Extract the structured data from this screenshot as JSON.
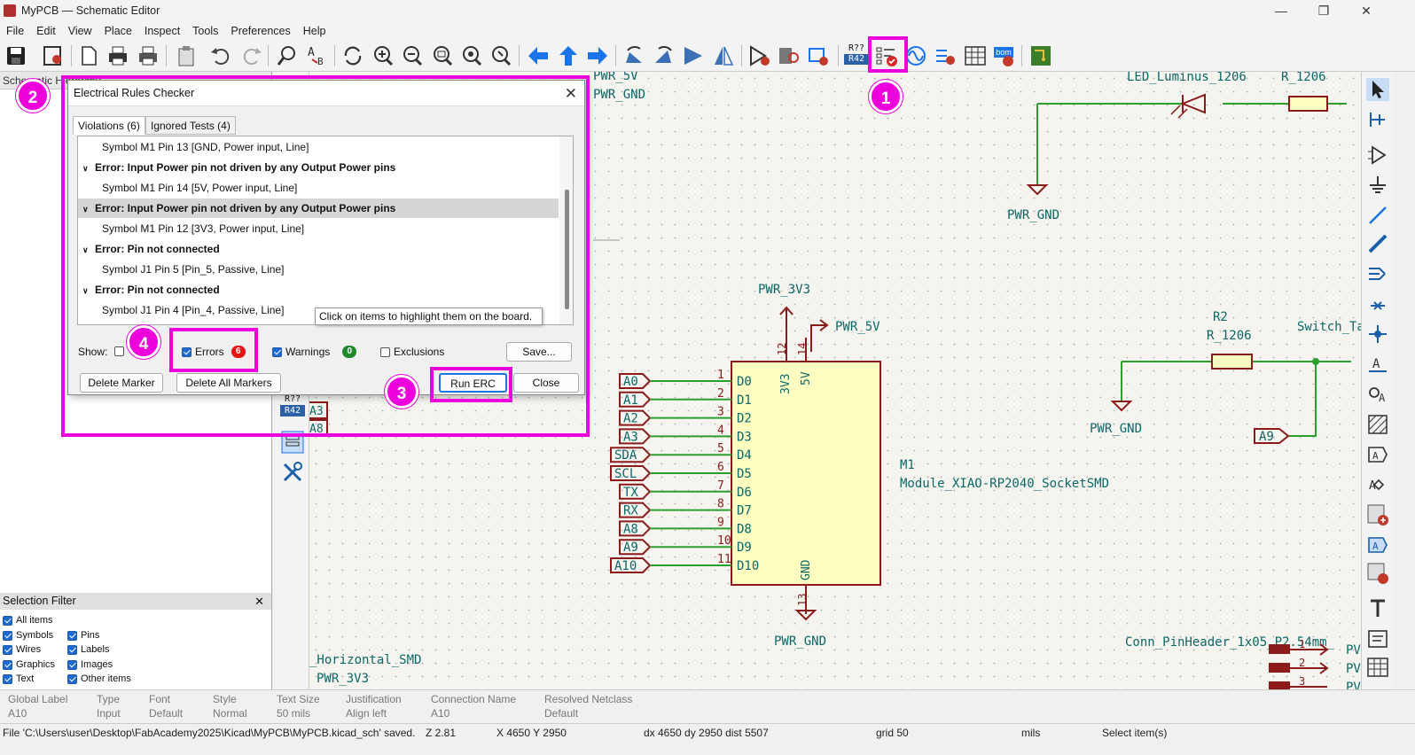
{
  "window": {
    "title": "MyPCB — Schematic Editor",
    "controls": {
      "minimize": "—",
      "maximize": "❐",
      "close": "✕"
    }
  },
  "menu": [
    "File",
    "Edit",
    "View",
    "Place",
    "Inspect",
    "Tools",
    "Preferences",
    "Help"
  ],
  "toolbar": {
    "icons": [
      "save-icon",
      "schematic-setup-icon",
      "page-settings-icon",
      "print-icon",
      "plot-icon",
      "paste-icon",
      "undo-icon",
      "redo-icon",
      "find-icon",
      "find-replace-icon",
      "refresh-icon",
      "zoom-in-icon",
      "zoom-out-icon",
      "zoom-fit-icon",
      "zoom-objects-icon",
      "zoom-tool-icon",
      "navigate-back-icon",
      "navigate-up-icon",
      "navigate-forward-icon",
      "rotate-ccw-icon",
      "rotate-cw-icon",
      "mirror-v-icon",
      "mirror-h-icon",
      "symbol-editor-icon",
      "symbol-browser-icon",
      "footprint-assign-icon",
      "annotate-icon",
      "erc-icon",
      "simulator-icon",
      "bus-icon",
      "fields-table-icon",
      "bom-icon",
      "pcb-editor-icon"
    ],
    "annotate_text_1": "R??",
    "annotate_text_2": "R42",
    "bom_text": "bom"
  },
  "left_panel": {
    "header": "Schematic Hierarchy"
  },
  "left_tools": {
    "annotate_text_1": "R??",
    "annotate_text_2": "R42"
  },
  "selection_filter": {
    "title": "Selection Filter",
    "close": "✕",
    "items": [
      {
        "label": "All items",
        "checked": true
      },
      {
        "label": "Symbols",
        "checked": true
      },
      {
        "label": "Pins",
        "checked": true
      },
      {
        "label": "Wires",
        "checked": true
      },
      {
        "label": "Labels",
        "checked": true
      },
      {
        "label": "Graphics",
        "checked": true
      },
      {
        "label": "Images",
        "checked": true
      },
      {
        "label": "Text",
        "checked": true
      },
      {
        "label": "Other items",
        "checked": true
      }
    ]
  },
  "dialog": {
    "title": "Electrical Rules Checker",
    "close": "✕",
    "tabs": [
      {
        "label": "Violations (6)"
      },
      {
        "label": "Ignored Tests (4)"
      }
    ],
    "violations": [
      {
        "kind": "sym",
        "text": "Symbol M1 Pin 13 [GND, Power input, Line]"
      },
      {
        "kind": "err",
        "text": "Error: Input Power pin not driven by any Output Power pins"
      },
      {
        "kind": "sym",
        "text": "Symbol M1 Pin 14 [5V, Power input, Line]"
      },
      {
        "kind": "err",
        "text": "Error: Input Power pin not driven by any Output Power pins",
        "selected": true
      },
      {
        "kind": "sym",
        "text": "Symbol M1 Pin 12 [3V3, Power input, Line]"
      },
      {
        "kind": "err",
        "text": "Error: Pin not connected"
      },
      {
        "kind": "sym",
        "text": "Symbol J1 Pin 5 [Pin_5, Passive, Line]"
      },
      {
        "kind": "err",
        "text": "Error: Pin not connected"
      },
      {
        "kind": "sym",
        "text": "Symbol J1 Pin 4 [Pin_4, Passive, Line]"
      }
    ],
    "tooltip": "Click on items to highlight them on the board.",
    "show_label": "Show:",
    "errors_label": "Errors",
    "errors_count": "6",
    "warnings_label": "Warnings",
    "warnings_count": "0",
    "exclusions_label": "Exclusions",
    "save_button": "Save...",
    "delete_marker_button": "Delete Marker",
    "delete_all_button": "Delete All Markers",
    "run_button": "Run ERC",
    "close_button": "Close"
  },
  "callouts": [
    "1",
    "2",
    "3",
    "4"
  ],
  "schematic": {
    "labels": {
      "top_pwr_5v": "PWR_5V",
      "top_pwr_gnd": "PWR_GND",
      "led_value": "LED_Luminus_1206",
      "r_top_value": "R_1206",
      "gnd_led": "PWR_GND",
      "pwr_3v3": "PWR_3V3",
      "pwr_5v": "PWR_5V",
      "r2_ref": "R2",
      "r2_value": "R_1206",
      "switch": "Switch_Ta",
      "gnd_r2": "PWR_GND",
      "a9_label": "A9",
      "m1_ref": "M1",
      "m1_value": "Module_XIAO-RP2040_SocketSMD",
      "gnd_m1": "PWR_GND",
      "conn_value": "Conn_PinHeader_1x05_P2.54mm_",
      "horiz_smd": "_Horizontal_SMD",
      "bottom_3v3": "PWR_3V3",
      "left_a3": "A3",
      "left_a8": "A8",
      "pin_3v3": "3V3",
      "pin_5v": "5V",
      "pin_gnd": "GND",
      "pin12": "12",
      "pin14": "14",
      "pin13": "13",
      "conn_pins": [
        "1",
        "2",
        "3"
      ],
      "conn_labels": [
        "PV",
        "PV",
        "PV"
      ]
    },
    "m1_pins": [
      {
        "net": "A0",
        "num": "1",
        "name": "D0"
      },
      {
        "net": "A1",
        "num": "2",
        "name": "D1"
      },
      {
        "net": "A2",
        "num": "3",
        "name": "D2"
      },
      {
        "net": "A3",
        "num": "4",
        "name": "D3"
      },
      {
        "net": "SDA",
        "num": "5",
        "name": "D4"
      },
      {
        "net": "SCL",
        "num": "6",
        "name": "D5"
      },
      {
        "net": "TX",
        "num": "7",
        "name": "D6"
      },
      {
        "net": "RX",
        "num": "8",
        "name": "D7"
      },
      {
        "net": "A8",
        "num": "9",
        "name": "D8"
      },
      {
        "net": "A9",
        "num": "10",
        "name": "D9"
      },
      {
        "net": "A10",
        "num": "11",
        "name": "D10"
      }
    ]
  },
  "properties_bar": {
    "headers": [
      "Global Label",
      "Type",
      "Font",
      "Style",
      "Text Size",
      "Justification",
      "Connection Name",
      "Resolved Netclass"
    ],
    "values": [
      "A10",
      "Input",
      "Default",
      "Normal",
      "50 mils",
      "Align left",
      "A10",
      "Default"
    ]
  },
  "status": {
    "file": "File 'C:\\Users\\user\\Desktop\\FabAcademy2025\\Kicad\\MyPCB\\MyPCB.kicad_sch' saved.",
    "zoom": "Z 2.81",
    "xy": "X 4650  Y 2950",
    "delta": "dx 4650  dy 2950  dist 5507",
    "grid": "grid 50",
    "units": "mils",
    "mode": "Select item(s)"
  },
  "colors": {
    "highlight": "#ee00dd",
    "wire": "#2e9e2e",
    "symbol": "#8b1a1a",
    "body": "#ffffc2",
    "text": "#0b6868"
  }
}
